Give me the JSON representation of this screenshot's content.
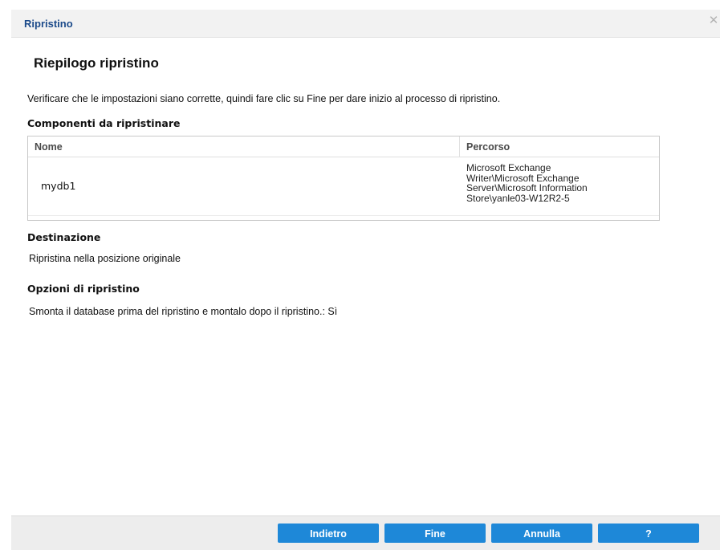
{
  "dialog": {
    "title": "Ripristino",
    "close_icon": "close-icon"
  },
  "summary": {
    "heading": "Riepilogo ripristino",
    "intro": "Verificare che le impostazioni siano corrette, quindi fare clic su Fine per dare inizio al processo di ripristino."
  },
  "components": {
    "label": "Componenti da ripristinare",
    "columns": [
      "Nome",
      "Percorso"
    ],
    "rows": [
      {
        "name": "mydb1",
        "path_lines": [
          "Microsoft Exchange",
          "Writer\\Microsoft Exchange",
          "Server\\Microsoft Information",
          "Store\\yanle03-W12R2-5"
        ]
      }
    ]
  },
  "destination": {
    "label": "Destinazione",
    "value": "Ripristina nella posizione originale"
  },
  "options": {
    "label": "Opzioni di ripristino",
    "value": "Smonta il database prima del ripristino e montalo dopo il ripristino.: Sì"
  },
  "footer": {
    "back_label": "Indietro",
    "finish_label": "Fine",
    "cancel_label": "Annulla",
    "help_label": "?"
  },
  "colors": {
    "title_text": "#1b4a8a",
    "button_bg": "#1e88d8"
  }
}
